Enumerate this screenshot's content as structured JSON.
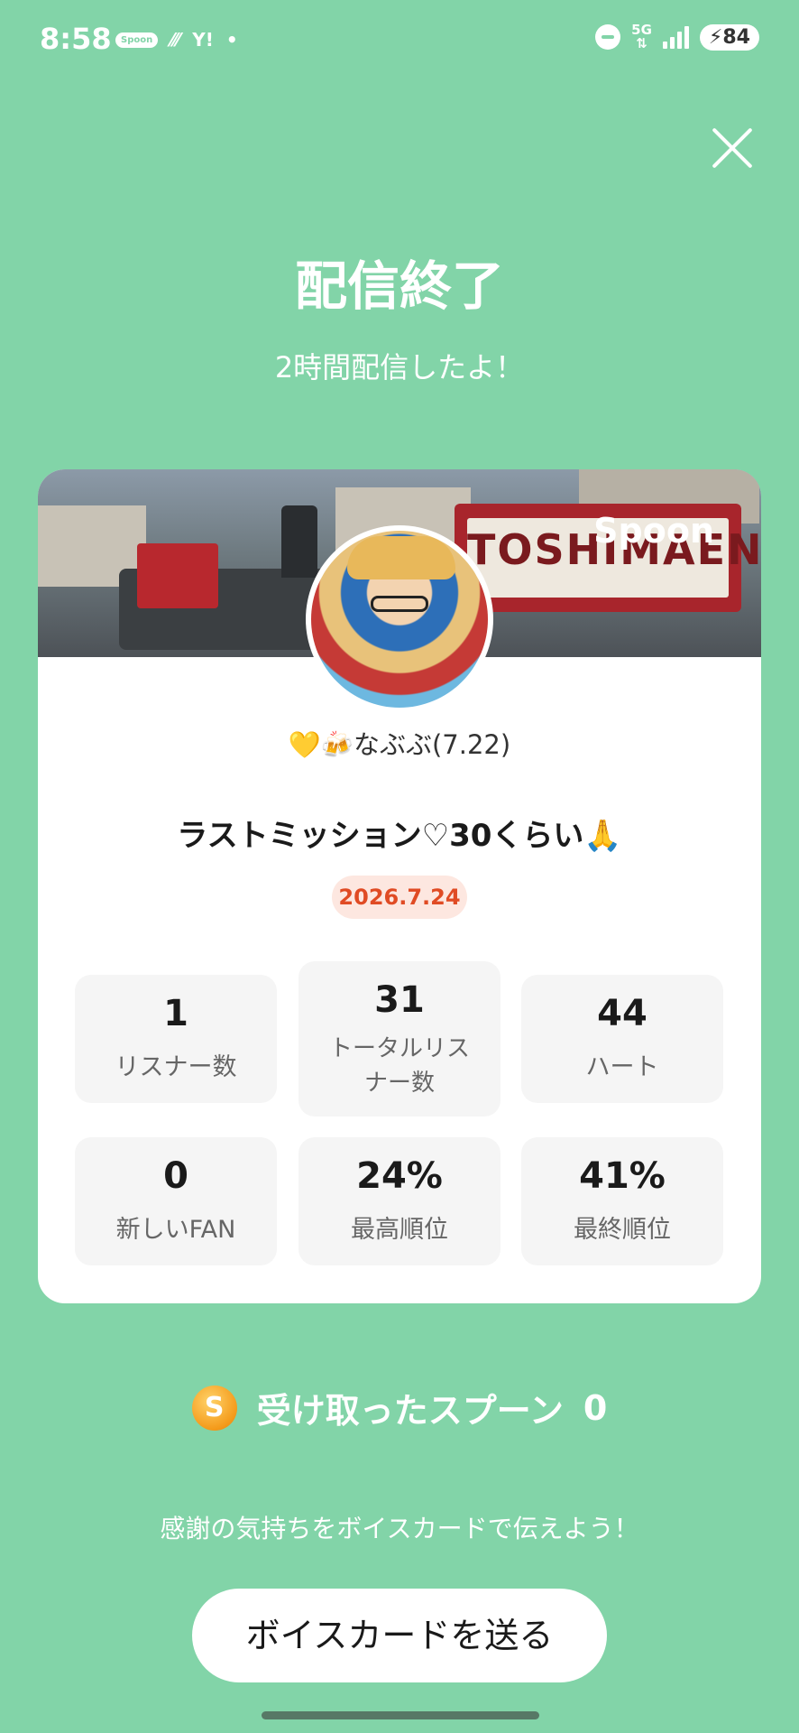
{
  "status": {
    "time": "8:58",
    "left_icons": [
      "Spoon",
      "Y!",
      "•"
    ],
    "network": "5G",
    "battery": "84"
  },
  "header": {
    "title": "配信終了",
    "subtitle": "2時間配信したよ！"
  },
  "card": {
    "banner_logo": "Spoon",
    "banner_sign": "TOSHIMAEN",
    "username": "💛🍻なぶぶ(7.22)",
    "stream_title": "ラストミッション♡30くらい🙏",
    "date": "2026.7.24",
    "stats": [
      {
        "value": "1",
        "label": "リスナー数"
      },
      {
        "value": "31",
        "label": "トータルリスナー数"
      },
      {
        "value": "44",
        "label": "ハート"
      },
      {
        "value": "0",
        "label": "新しいFAN"
      },
      {
        "value": "24%",
        "label": "最高順位"
      },
      {
        "value": "41%",
        "label": "最終順位"
      }
    ]
  },
  "spoons": {
    "icon_letter": "S",
    "label": "受け取ったスプーン",
    "count": "0"
  },
  "footer": {
    "thanks_text": "感謝の気持ちをボイスカードで伝えよう！",
    "voice_card_button": "ボイスカードを送る"
  },
  "colors": {
    "background": "#82d4a8",
    "date_badge_text": "#e04b24",
    "date_badge_bg": "#fde7e0"
  }
}
